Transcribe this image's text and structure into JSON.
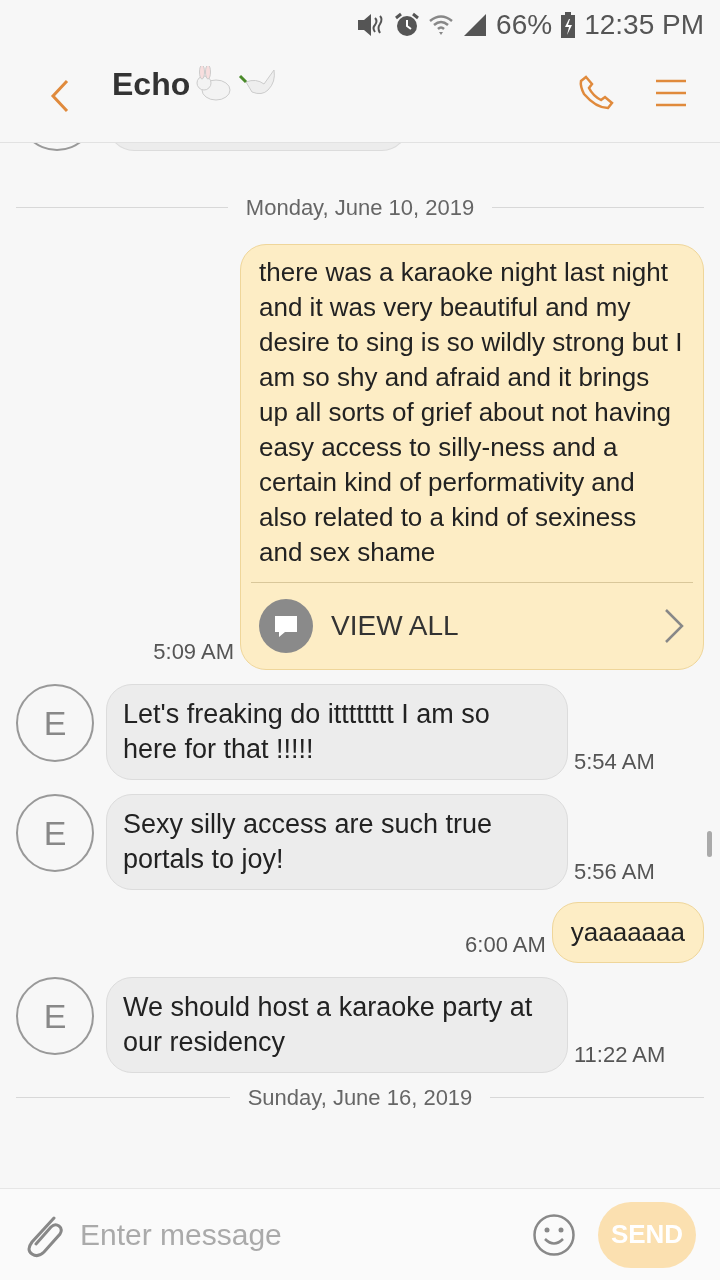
{
  "status_bar": {
    "battery": "66%",
    "time": "12:35 PM"
  },
  "header": {
    "title": "Echo"
  },
  "messages": [
    {
      "kind": "date",
      "text": "Monday, June 10, 2019"
    },
    {
      "kind": "out",
      "text": "there was a karaoke night last night and it was very beautiful and my desire to sing is so wildly strong but I am so shy and afraid and it brings up all sorts of grief about not having easy access to silly-ness and a certain kind of performativity and also related to a kind of sexiness and sex shame",
      "time": "5:09 AM",
      "view_all": "VIEW ALL"
    },
    {
      "kind": "in",
      "avatar": "E",
      "text": "Let's freaking do itttttttt I am so here for that !!!!!",
      "time": "5:54 AM"
    },
    {
      "kind": "in",
      "avatar": "E",
      "text": "Sexy silly access are such true portals to joy!",
      "time": "5:56 AM"
    },
    {
      "kind": "out",
      "text": "yaaaaaaa",
      "time": "6:00 AM"
    },
    {
      "kind": "in",
      "avatar": "E",
      "text": "We should host a karaoke party at our residency",
      "time": "11:22 AM"
    },
    {
      "kind": "date",
      "text": "Sunday, June 16, 2019"
    }
  ],
  "composer": {
    "placeholder": "Enter message",
    "send": "SEND"
  }
}
